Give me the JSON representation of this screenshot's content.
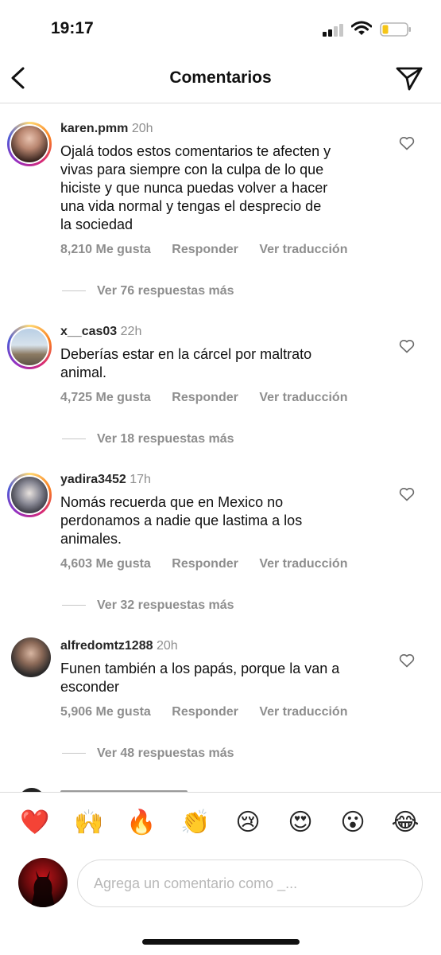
{
  "status": {
    "time": "19:17"
  },
  "header": {
    "title": "Comentarios"
  },
  "comments": [
    {
      "username": "karen.pmm",
      "time": "20h",
      "lines": [
        "Ojalá todos estos comentarios te afecten y",
        "vivas para siempre con la culpa de lo que",
        "hiciste y que nunca puedas volver a hacer",
        "una vida normal  y tengas el desprecio de",
        "la sociedad"
      ],
      "likes": "8,210 Me gusta",
      "reply": "Responder",
      "translate": "Ver traducción",
      "more_replies": "Ver 76 respuestas más"
    },
    {
      "username": "x__cas03",
      "time": "22h",
      "lines": [
        "Deberías estar en la cárcel por maltrato",
        "animal."
      ],
      "likes": "4,725 Me gusta",
      "reply": "Responder",
      "translate": "Ver traducción",
      "more_replies": "Ver 18 respuestas más"
    },
    {
      "username": "yadira3452",
      "time": "17h",
      "lines": [
        "Nomás recuerda que en Mexico no",
        "perdonamos a nadie que lastima a los",
        "animales."
      ],
      "likes": "4,603 Me gusta",
      "reply": "Responder",
      "translate": "Ver traducción",
      "more_replies": "Ver 32 respuestas más"
    },
    {
      "username": "alfredomtz1288",
      "time": "20h",
      "lines": [
        "Funen también a los papás, porque la van a",
        "esconder"
      ],
      "likes": "5,906 Me gusta",
      "reply": "Responder",
      "translate": "Ver traducción",
      "more_replies": "Ver 48 respuestas más"
    }
  ],
  "reactions": [
    {
      "icon": "red-heart-icon",
      "glyph": "❤️"
    },
    {
      "icon": "raising-hands-icon",
      "glyph": "🙌"
    },
    {
      "icon": "fire-icon",
      "glyph": "🔥"
    },
    {
      "icon": "clapping-hands-icon",
      "glyph": "👏"
    },
    {
      "icon": "crying-face-icon",
      "glyph": "😢"
    },
    {
      "icon": "heart-eyes-icon",
      "glyph": "😍"
    },
    {
      "icon": "surprised-face-icon",
      "glyph": "😮"
    },
    {
      "icon": "tears-of-joy-icon",
      "glyph": "😂"
    }
  ],
  "composer": {
    "placeholder": "Agrega un comentario como _..."
  },
  "colors": {
    "text": "#262626",
    "secondary": "#8e8e8e",
    "divider": "#dbdbdb"
  }
}
